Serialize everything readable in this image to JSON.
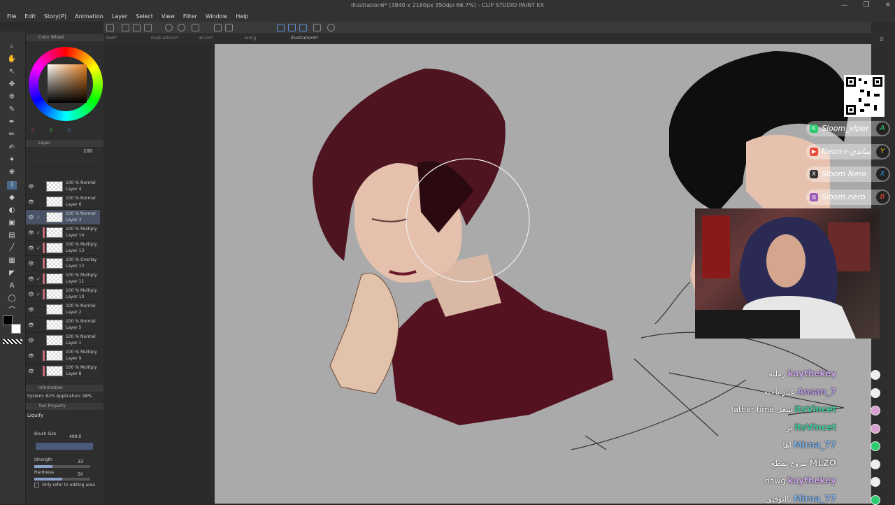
{
  "window": {
    "title": "Illustration6* (3840 x 2160px 350dpi 66.7%) - CLIP STUDIO PAINT EX",
    "controls": [
      "—",
      "❐",
      "✕"
    ]
  },
  "menu": [
    "File",
    "Edit",
    "Story(P)",
    "Animation",
    "Layer",
    "Select",
    "View",
    "Filter",
    "Window",
    "Help"
  ],
  "tabs": [
    {
      "label": "text*"
    },
    {
      "label": "illustration2*"
    },
    {
      "label": "all.cort"
    },
    {
      "label": "end.jj"
    },
    {
      "label": "Illustration6*",
      "active": true
    }
  ],
  "color_panel": {
    "title": "Color Wheel",
    "rgb": [
      "0",
      "0",
      "0"
    ]
  },
  "layer_panel": {
    "title": "Layer",
    "opacity": "100",
    "layers": [
      {
        "mode": "100 % Normal",
        "name": "Layer 4",
        "clip": false,
        "checked": false
      },
      {
        "mode": "100 % Normal",
        "name": "Layer 6",
        "clip": false,
        "checked": false
      },
      {
        "mode": "100 % Normal",
        "name": "Layer 3",
        "clip": false,
        "checked": true,
        "selected": true
      },
      {
        "mode": "100 % Multiply",
        "name": "Layer 14",
        "clip": true,
        "checked": true
      },
      {
        "mode": "100 % Multiply",
        "name": "Layer 13",
        "clip": true,
        "checked": true
      },
      {
        "mode": "100 % Overlay",
        "name": "Layer 12",
        "clip": true,
        "checked": false
      },
      {
        "mode": "100 % Multiply",
        "name": "Layer 11",
        "clip": true,
        "checked": true
      },
      {
        "mode": "100 % Multiply",
        "name": "Layer 10",
        "clip": true,
        "checked": true
      },
      {
        "mode": "100 % Normal",
        "name": "Layer 2",
        "clip": false,
        "checked": false
      },
      {
        "mode": "100 % Normal",
        "name": "Layer 5",
        "clip": false,
        "checked": false
      },
      {
        "mode": "100 % Normal",
        "name": "Layer 1",
        "clip": false,
        "checked": false
      },
      {
        "mode": "100 % Multiply",
        "name": "Layer 9",
        "clip": true,
        "checked": false
      },
      {
        "mode": "100 % Multiply",
        "name": "Layer 8",
        "clip": true,
        "checked": false
      }
    ]
  },
  "info": {
    "title": "Information",
    "system": "System: 82% Application: 98%"
  },
  "tool_property": {
    "title": "Tool Property",
    "tool": "Liquify",
    "brush_size_label": "Brush Size",
    "brush_size": "400.0",
    "strength_label": "Strength",
    "strength": "33",
    "strength_level": 0.33,
    "hardness_label": "Hardness",
    "hardness": "50",
    "hardness_level": 0.5,
    "refer_label": "Only refer to editing area"
  },
  "socials": [
    {
      "handle": "Sloom_viper",
      "end": "A",
      "color": "#2ecc71"
    },
    {
      "handle": "Neon-r-ساندي",
      "end": "Y",
      "color": "#e74c3c"
    },
    {
      "handle": "Sloom Nero",
      "end": "X",
      "color": "#555555"
    },
    {
      "handle": "Sloom.nero",
      "end": "B",
      "color": "#9b59b6"
    }
  ],
  "chat": [
    {
      "msg": "رمليه",
      "user": "kaythekey",
      "color": "#c9a3e6"
    },
    {
      "msg": "عبار ياحبه",
      "user": "Ansan_7",
      "color": "#b497e0"
    },
    {
      "msg": "father time شغل",
      "user": "itsVincet",
      "color": "#3ec9a0"
    },
    {
      "msg": "نز",
      "user": "itsVincet",
      "color": "#3ec9a0"
    },
    {
      "msg": "اها",
      "user": "Mirna_77",
      "color": "#7fb0e8"
    },
    {
      "msg": "بتروح تقطع",
      "user": "MLZO",
      "color": "#d8d8d8"
    },
    {
      "msg": "dawg",
      "user": "kaythekey",
      "color": "#c9a3e6"
    },
    {
      "msg": "بالتوفيق",
      "user": "Mirna_77",
      "color": "#7fb0e8"
    }
  ]
}
